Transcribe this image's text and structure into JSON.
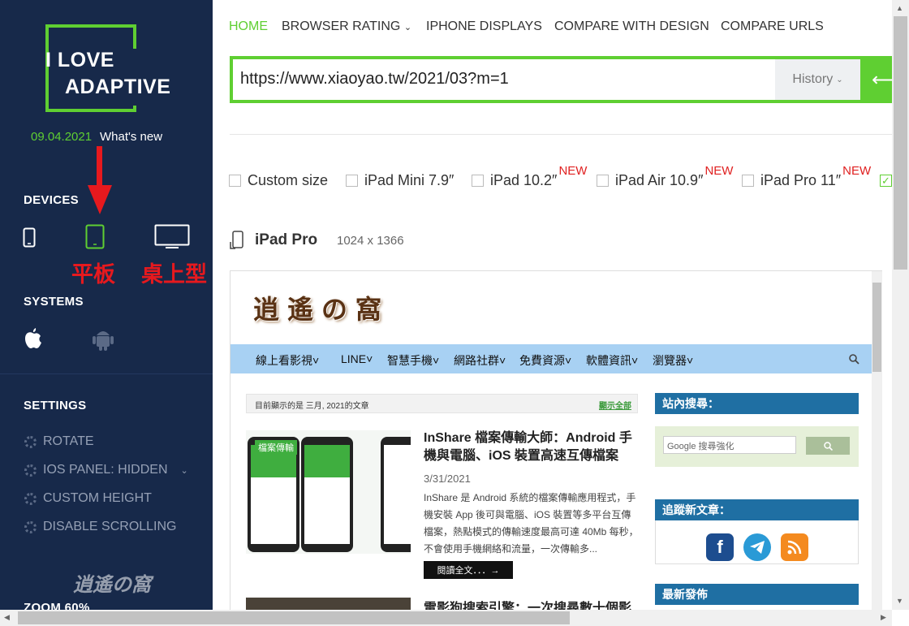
{
  "sidebar": {
    "logo_line1": "I LOVE",
    "logo_line2": "ADAPTIVE",
    "version_date": "09.04.2021",
    "whats_new": "What's new",
    "devices_title": "DEVICES",
    "systems_title": "SYSTEMS",
    "settings_title": "SETTINGS",
    "settings": [
      {
        "label": "ROTATE"
      },
      {
        "label": "IOS PANEL:  HIDDEN"
      },
      {
        "label": "CUSTOM HEIGHT"
      },
      {
        "label": "DISABLE SCROLLING"
      }
    ],
    "zoom": "ZOOM 60%",
    "annotation_tablet": "平板",
    "annotation_desktop": "桌上型",
    "watermark": "逍遙の窩"
  },
  "nav": {
    "home": "HOME",
    "browser_rating": "BROWSER RATING",
    "iphone_displays": "IPHONE DISPLAYS",
    "compare_design": "COMPARE WITH DESIGN",
    "compare_urls": "COMPARE URLS"
  },
  "url_bar": {
    "value": "https://www.xiaoyao.tw/2021/03?m=1",
    "history_label": "History"
  },
  "devices": [
    {
      "label": "Custom size",
      "new": ""
    },
    {
      "label": "iPad Mini 7.9″",
      "new": ""
    },
    {
      "label": "iPad 10.2″",
      "new": "NEW"
    },
    {
      "label": "iPad Air 10.9″",
      "new": "NEW"
    },
    {
      "label": "iPad Pro 11″",
      "new": "NEW"
    }
  ],
  "preview": {
    "device_name": "iPad Pro",
    "resolution": "1024 x 1366"
  },
  "site": {
    "logo": "逍遙の窩",
    "menu": [
      "線上看影視",
      "LINE",
      "智慧手機",
      "網路社群",
      "免費資源",
      "軟體資訊",
      "瀏覽器"
    ],
    "archive_text": "目前顯示的是 三月, 2021的文章",
    "show_all": "顯示全部",
    "search_title": "站內搜尋：",
    "search_placeholder": "Google 搜尋強化",
    "follow_title": "追蹤新文章：",
    "latest_title": "最新發佈",
    "article": {
      "tag": "檔案傳輸",
      "title": "InShare 檔案傳輸大師：Android 手機與電腦、iOS 裝置高速互傳檔案",
      "date": "3/31/2021",
      "excerpt": "InShare 是 Android 系統的檔案傳輸應用程式，手機安裝 App 後可與電腦、iOS 裝置等多平台互傳檔案，熱點模式的傳輸速度最高可達 40Mb 每秒，不會使用手機網絡和流量，一次傳輸多...",
      "read_more": "閱讀全文．．．→"
    },
    "article2_title": "電影狗搜索引擎：一次搜尋數十個影"
  },
  "colors": {
    "sidebar_bg": "#17294a",
    "accent_green": "#5fcf32",
    "annotation_red": "#e6191e",
    "site_menu_bg": "#a8d1f3",
    "widget_title_bg": "#1f6fa3"
  }
}
